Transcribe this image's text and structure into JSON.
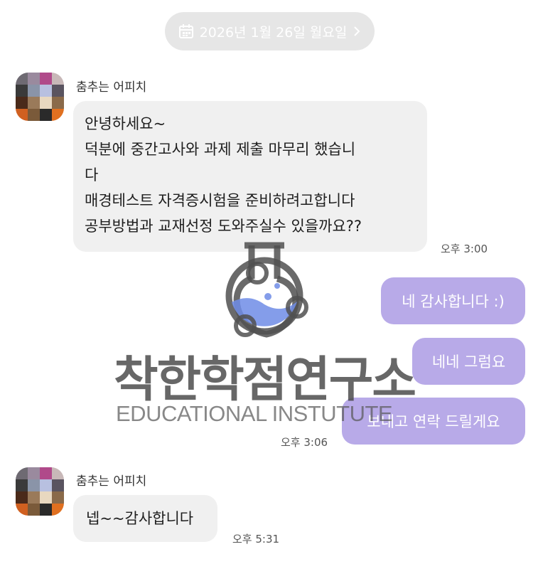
{
  "date_header": {
    "label": "2026년 1월 26일 월요일",
    "icon": "calendar-icon",
    "chevron_icon": "chevron-right-icon"
  },
  "colors": {
    "outgoing_bubble": "#b8aae8",
    "incoming_bubble": "#f0f0f0",
    "date_pill": "#e6e6e6"
  },
  "messages": {
    "group1": {
      "sender": "춤추는 어피치",
      "lines": [
        "안녕하세요~",
        "덕분에 중간고사와 과제 제출 마무리 했습니",
        "다",
        "매경테스트 자격증시험을 준비하려고합니다",
        "공부방법과 교재선정 도와주실수 있을까요??"
      ],
      "time": "오후 3:00"
    },
    "outgoing": {
      "bubbles": [
        "네 감사합니다 :)",
        "네네 그럼요",
        "보내고 연락 드릴게요"
      ],
      "time": "오후 3:06"
    },
    "group2": {
      "sender": "춤추는 어피치",
      "text": "넵~~감사합니다",
      "time": "오후 5:31"
    }
  },
  "watermark": {
    "title": "착한학점연구소",
    "subtitle": "EDUCATIONAL INSTUTUTE",
    "icon": "flask-logo-icon"
  }
}
